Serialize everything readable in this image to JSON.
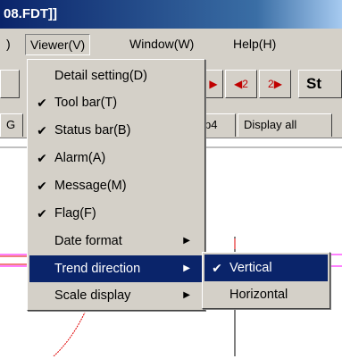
{
  "title": "08.FDT]]",
  "menubar": [
    {
      "label": ")",
      "active": false
    },
    {
      "label": "Viewer(V)",
      "active": true
    },
    {
      "label": "Window(W)",
      "active": false
    },
    {
      "label": "Help(H)",
      "active": false
    }
  ],
  "toolbar": {
    "btn_next_label": "▶",
    "btn_prev2_label": "◀2",
    "btn_next2_label": "2▶",
    "status_text": "St"
  },
  "tabs": {
    "left_partial": "G",
    "tab4_partial": "p4",
    "display_all": "Display all"
  },
  "viewer_menu": {
    "items": [
      {
        "label": "Detail setting(D)",
        "checked": false,
        "submenu": false
      },
      {
        "label": "Tool bar(T)",
        "checked": true,
        "submenu": false
      },
      {
        "label": "Status bar(B)",
        "checked": true,
        "submenu": false
      },
      {
        "label": "Alarm(A)",
        "checked": true,
        "submenu": false
      },
      {
        "label": "Message(M)",
        "checked": true,
        "submenu": false
      },
      {
        "label": "Flag(F)",
        "checked": true,
        "submenu": false
      },
      {
        "label": "Date format",
        "checked": false,
        "submenu": true
      },
      {
        "label": "Trend direction",
        "checked": false,
        "submenu": true,
        "highlighted": true
      },
      {
        "label": "Scale display",
        "checked": false,
        "submenu": true
      }
    ],
    "check_glyph": "✔",
    "arrow_glyph": "▶"
  },
  "trend_submenu": {
    "items": [
      {
        "label": "Vertical",
        "checked": true,
        "highlighted": true
      },
      {
        "label": "Horizontal",
        "checked": false,
        "highlighted": false
      }
    ]
  },
  "colors": {
    "menu_bg": "#d4d0c8",
    "highlight": "#0a246a",
    "trend_red": "#e00000",
    "trend_magenta": "#ff00ff"
  }
}
